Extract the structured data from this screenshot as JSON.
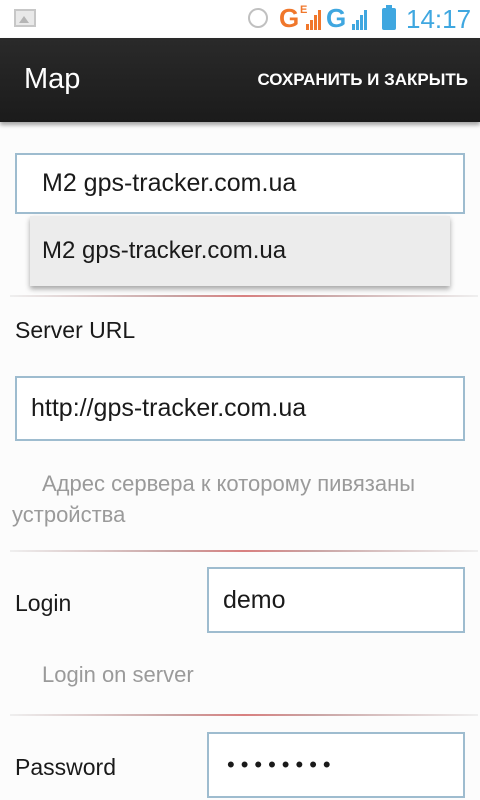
{
  "status_bar": {
    "network_letter_1": "G",
    "network_letter_e": "E",
    "network_letter_2": "G",
    "time": "14:17",
    "icons": [
      "gallery-icon",
      "alarm-icon",
      "signal-icon",
      "battery-icon"
    ],
    "accent_orange": "#f0772b",
    "accent_blue": "#3fa7e0"
  },
  "action_bar": {
    "title": "Map",
    "save_close_label": "СОХРАНИТЬ И ЗАКРЫТЬ"
  },
  "map_provider": {
    "selected_value": "M2 gps-tracker.com.ua",
    "options": [
      "M2 gps-tracker.com.ua"
    ]
  },
  "server_url": {
    "label": "Server URL",
    "value": "http://gps-tracker.com.ua",
    "hint": "Адрес сервера к которому пивязаны устройства"
  },
  "login": {
    "label": "Login",
    "value": "demo",
    "hint": "Login on server"
  },
  "password": {
    "label": "Password",
    "masked_value": "••••••••"
  }
}
